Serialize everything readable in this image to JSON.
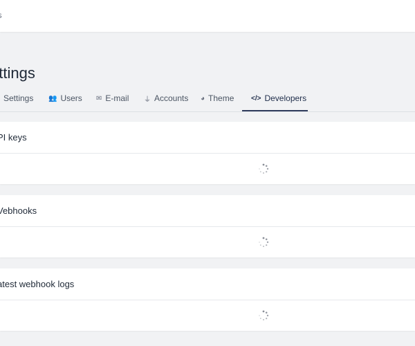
{
  "breadcrumb": "gs",
  "page_title": "ettings",
  "tabs": [
    {
      "label": "Settings",
      "icon": "gear-icon",
      "glyph": ""
    },
    {
      "label": "Users",
      "icon": "users-icon",
      "glyph": "👥"
    },
    {
      "label": "E-mail",
      "icon": "envelope-icon",
      "glyph": "✉"
    },
    {
      "label": "Accounts",
      "icon": "plug-icon",
      "glyph": "⏚"
    },
    {
      "label": "Theme",
      "icon": "palette-icon",
      "glyph": "◕"
    },
    {
      "label": "Developers",
      "icon": "code-icon",
      "glyph": "</>",
      "active": true
    }
  ],
  "sections": [
    {
      "title": "PI keys",
      "loading": true
    },
    {
      "title": "Vebhooks",
      "loading": true
    },
    {
      "title": "atest webhook logs",
      "loading": true
    }
  ],
  "colors": {
    "accent": "#2f3b5c",
    "background": "#f1f2f4"
  }
}
